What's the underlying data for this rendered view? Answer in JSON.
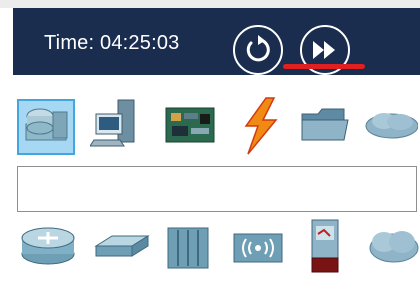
{
  "simulation": {
    "time_prefix": "Time: ",
    "time_value": "04:25:03",
    "controls": [
      {
        "name": "reset-simulation-button",
        "icon": "reset-time-icon"
      },
      {
        "name": "fast-forward-button",
        "icon": "fast-forward-icon",
        "underline_color": "#e02020"
      }
    ]
  },
  "device_categories": [
    {
      "icon": "network-devices-icon",
      "selected": true
    },
    {
      "icon": "end-devices-icon",
      "selected": false
    },
    {
      "icon": "components-icon",
      "selected": false
    },
    {
      "icon": "connections-icon",
      "selected": false
    },
    {
      "icon": "miscellaneous-icon",
      "selected": false
    },
    {
      "icon": "multiuser-connection-icon",
      "selected": false
    }
  ],
  "search": {
    "value": "",
    "placeholder": ""
  },
  "device_subtypes": [
    {
      "icon": "routers-icon"
    },
    {
      "icon": "switches-icon"
    },
    {
      "icon": "hubs-icon"
    },
    {
      "icon": "wireless-devices-icon"
    },
    {
      "icon": "security-icon"
    },
    {
      "icon": "wan-emulation-icon"
    }
  ],
  "colors": {
    "time_bar": "#1b2d4f",
    "selection_fill": "#a7d8f3",
    "selection_border": "#43a6de",
    "accent_underline": "#e02020"
  }
}
